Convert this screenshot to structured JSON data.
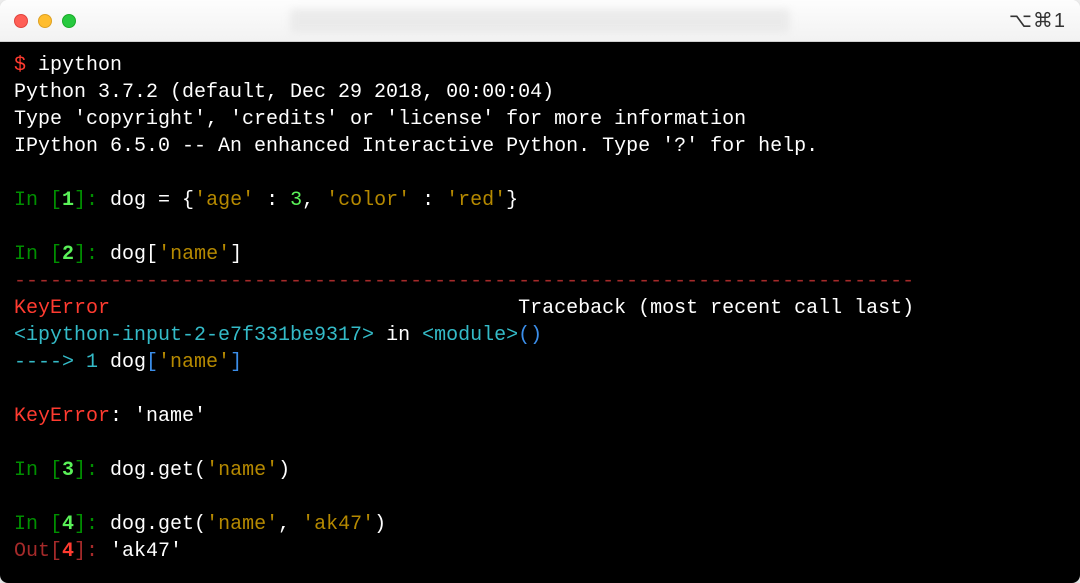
{
  "titlebar": {
    "shortcut": "⌥⌘1"
  },
  "term": {
    "shell_prompt": "$ ",
    "shell_cmd": "ipython",
    "banner1": "Python 3.7.2 (default, Dec 29 2018, 00:00:04) ",
    "banner2": "Type 'copyright', 'credits' or 'license' for more information",
    "banner3": "IPython 6.5.0 -- An enhanced Interactive Python. Type '?' for help.",
    "in_label": "In [",
    "in_close": "]: ",
    "out_label": "Out[",
    "out_close": "]: ",
    "n1": "1",
    "n2": "2",
    "n3": "3",
    "n4": "4",
    "line1_a": "dog = {",
    "line1_b": "'age'",
    "line1_c": " : ",
    "line1_d": "3",
    "line1_e": ", ",
    "line1_f": "'color'",
    "line1_g": " : ",
    "line1_h": "'red'",
    "line1_i": "}",
    "line2_a": "dog[",
    "line2_b": "'name'",
    "line2_c": "]",
    "dashline": "---------------------------------------------------------------------------",
    "err_name": "KeyError",
    "err_trace": "                                  Traceback (most recent call last)",
    "tb1_a": "<ipython-input-2-e7f331be9317>",
    "tb1_b": " in ",
    "tb1_c": "<module>",
    "tb1_d": "()",
    "tb2_a": "----> 1",
    "tb2_b": " dog",
    "tb2_c": "[",
    "tb2_d": "'name'",
    "tb2_e": "]",
    "err2_a": "KeyError",
    "err2_b": ": 'name'",
    "line3_a": "dog.get(",
    "line3_b": "'name'",
    "line3_c": ")",
    "line4_a": "dog.get(",
    "line4_b": "'name'",
    "line4_c": ", ",
    "line4_d": "'ak47'",
    "line4_e": ")",
    "out4": "'ak47'"
  }
}
